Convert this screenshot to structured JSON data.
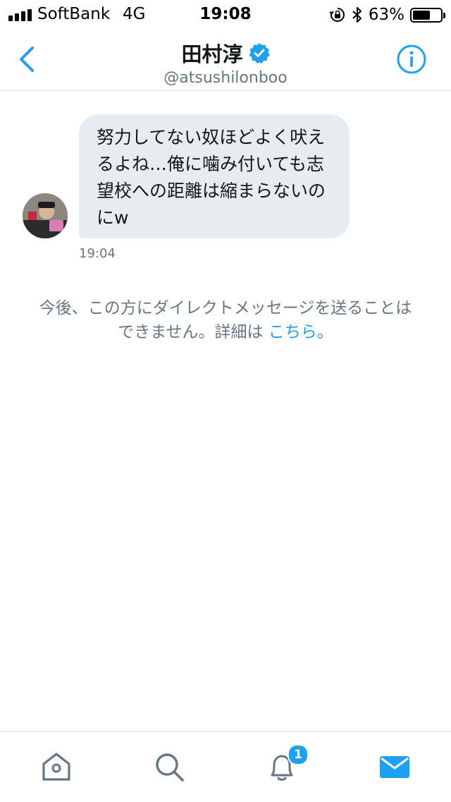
{
  "status_bar": {
    "carrier": "SoftBank",
    "network": "4G",
    "time": "19:08",
    "battery_percent": "63%",
    "battery_level": 0.63,
    "icons": [
      "signal-bars-icon",
      "orientation-lock-icon",
      "bluetooth-icon",
      "battery-icon"
    ]
  },
  "conversation": {
    "name": "田村淳",
    "handle": "@atsushilonboo",
    "verified": true,
    "icons": [
      "back-chevron-icon",
      "verified-badge-icon",
      "info-icon"
    ]
  },
  "messages": [
    {
      "text": "努力してない奴ほどよく吠えるよね…俺に噛み付いても志望校への距離は縮まらないのにw",
      "time": "19:04"
    }
  ],
  "notice": {
    "line1": "今後、この方にダイレクトメッセージを送ることは",
    "line2": "できません。詳細は ",
    "link": "こちら。"
  },
  "tab_bar": {
    "tabs": [
      {
        "name": "home",
        "icon": "home-icon",
        "active": false
      },
      {
        "name": "search",
        "icon": "search-icon",
        "active": false
      },
      {
        "name": "notifications",
        "icon": "bell-icon",
        "active": false,
        "badge": "1"
      },
      {
        "name": "messages",
        "icon": "mail-icon",
        "active": true
      }
    ]
  },
  "colors": {
    "accent": "#1da1f2",
    "bubble": "#e6ecf0",
    "secondary_text": "#657786",
    "inactive_icon": "#657786"
  }
}
